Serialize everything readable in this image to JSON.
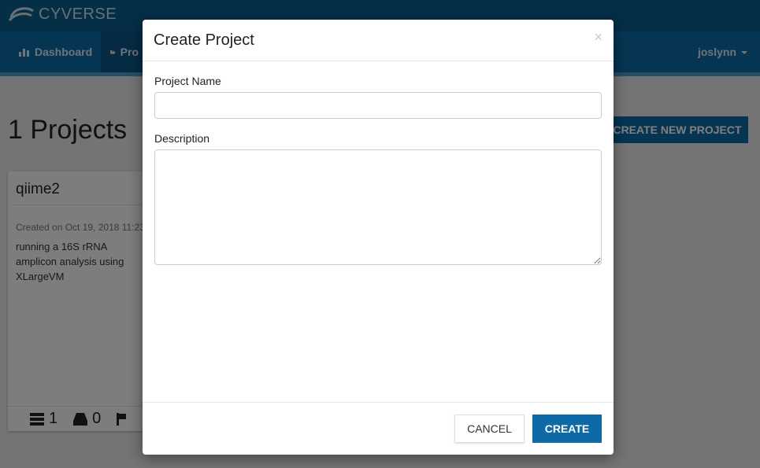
{
  "app": {
    "logo_text": "CYVERSE",
    "nav_items": [
      {
        "label": "Dashboard",
        "icon": "bar-chart-icon"
      },
      {
        "label": "Pro",
        "icon": "folder-open-icon"
      }
    ],
    "user_menu_label": "joslynn"
  },
  "page": {
    "title": "1 Projects",
    "create_new_project_label": "CREATE NEW PROJECT",
    "project_card": {
      "title": "qiime2",
      "created": "Created on Oct 19, 2018 11:23",
      "description": "running a 16S rRNA amplicon analysis using XLargeVM",
      "instances_count": "1",
      "volumes_count": "0"
    }
  },
  "modal": {
    "title": "Create Project",
    "close_glyph": "×",
    "project_name_label": "Project Name",
    "project_name_value": "",
    "description_label": "Description",
    "description_value": "",
    "cancel_label": "CANCEL",
    "create_label": "CREATE"
  },
  "colors": {
    "brand_primary": "#0d6aa6",
    "brand_dark": "#0a5c8f",
    "overlay": "rgba(0,0,0,0.5)"
  }
}
